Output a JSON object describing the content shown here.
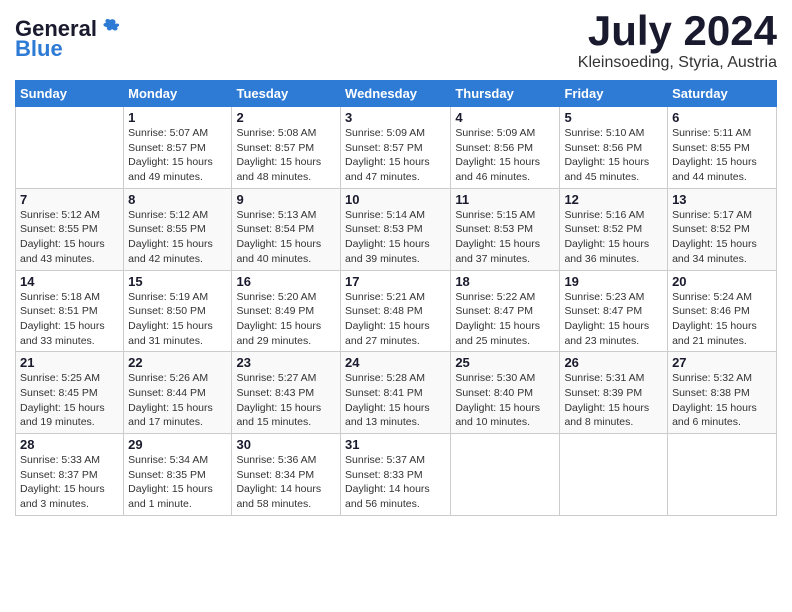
{
  "header": {
    "logo_general": "General",
    "logo_blue": "Blue",
    "month_title": "July 2024",
    "location": "Kleinsoeding, Styria, Austria"
  },
  "calendar": {
    "columns": [
      "Sunday",
      "Monday",
      "Tuesday",
      "Wednesday",
      "Thursday",
      "Friday",
      "Saturday"
    ],
    "weeks": [
      [
        {
          "day": "",
          "info": ""
        },
        {
          "day": "1",
          "info": "Sunrise: 5:07 AM\nSunset: 8:57 PM\nDaylight: 15 hours\nand 49 minutes."
        },
        {
          "day": "2",
          "info": "Sunrise: 5:08 AM\nSunset: 8:57 PM\nDaylight: 15 hours\nand 48 minutes."
        },
        {
          "day": "3",
          "info": "Sunrise: 5:09 AM\nSunset: 8:57 PM\nDaylight: 15 hours\nand 47 minutes."
        },
        {
          "day": "4",
          "info": "Sunrise: 5:09 AM\nSunset: 8:56 PM\nDaylight: 15 hours\nand 46 minutes."
        },
        {
          "day": "5",
          "info": "Sunrise: 5:10 AM\nSunset: 8:56 PM\nDaylight: 15 hours\nand 45 minutes."
        },
        {
          "day": "6",
          "info": "Sunrise: 5:11 AM\nSunset: 8:55 PM\nDaylight: 15 hours\nand 44 minutes."
        }
      ],
      [
        {
          "day": "7",
          "info": "Sunrise: 5:12 AM\nSunset: 8:55 PM\nDaylight: 15 hours\nand 43 minutes."
        },
        {
          "day": "8",
          "info": "Sunrise: 5:12 AM\nSunset: 8:55 PM\nDaylight: 15 hours\nand 42 minutes."
        },
        {
          "day": "9",
          "info": "Sunrise: 5:13 AM\nSunset: 8:54 PM\nDaylight: 15 hours\nand 40 minutes."
        },
        {
          "day": "10",
          "info": "Sunrise: 5:14 AM\nSunset: 8:53 PM\nDaylight: 15 hours\nand 39 minutes."
        },
        {
          "day": "11",
          "info": "Sunrise: 5:15 AM\nSunset: 8:53 PM\nDaylight: 15 hours\nand 37 minutes."
        },
        {
          "day": "12",
          "info": "Sunrise: 5:16 AM\nSunset: 8:52 PM\nDaylight: 15 hours\nand 36 minutes."
        },
        {
          "day": "13",
          "info": "Sunrise: 5:17 AM\nSunset: 8:52 PM\nDaylight: 15 hours\nand 34 minutes."
        }
      ],
      [
        {
          "day": "14",
          "info": "Sunrise: 5:18 AM\nSunset: 8:51 PM\nDaylight: 15 hours\nand 33 minutes."
        },
        {
          "day": "15",
          "info": "Sunrise: 5:19 AM\nSunset: 8:50 PM\nDaylight: 15 hours\nand 31 minutes."
        },
        {
          "day": "16",
          "info": "Sunrise: 5:20 AM\nSunset: 8:49 PM\nDaylight: 15 hours\nand 29 minutes."
        },
        {
          "day": "17",
          "info": "Sunrise: 5:21 AM\nSunset: 8:48 PM\nDaylight: 15 hours\nand 27 minutes."
        },
        {
          "day": "18",
          "info": "Sunrise: 5:22 AM\nSunset: 8:47 PM\nDaylight: 15 hours\nand 25 minutes."
        },
        {
          "day": "19",
          "info": "Sunrise: 5:23 AM\nSunset: 8:47 PM\nDaylight: 15 hours\nand 23 minutes."
        },
        {
          "day": "20",
          "info": "Sunrise: 5:24 AM\nSunset: 8:46 PM\nDaylight: 15 hours\nand 21 minutes."
        }
      ],
      [
        {
          "day": "21",
          "info": "Sunrise: 5:25 AM\nSunset: 8:45 PM\nDaylight: 15 hours\nand 19 minutes."
        },
        {
          "day": "22",
          "info": "Sunrise: 5:26 AM\nSunset: 8:44 PM\nDaylight: 15 hours\nand 17 minutes."
        },
        {
          "day": "23",
          "info": "Sunrise: 5:27 AM\nSunset: 8:43 PM\nDaylight: 15 hours\nand 15 minutes."
        },
        {
          "day": "24",
          "info": "Sunrise: 5:28 AM\nSunset: 8:41 PM\nDaylight: 15 hours\nand 13 minutes."
        },
        {
          "day": "25",
          "info": "Sunrise: 5:30 AM\nSunset: 8:40 PM\nDaylight: 15 hours\nand 10 minutes."
        },
        {
          "day": "26",
          "info": "Sunrise: 5:31 AM\nSunset: 8:39 PM\nDaylight: 15 hours\nand 8 minutes."
        },
        {
          "day": "27",
          "info": "Sunrise: 5:32 AM\nSunset: 8:38 PM\nDaylight: 15 hours\nand 6 minutes."
        }
      ],
      [
        {
          "day": "28",
          "info": "Sunrise: 5:33 AM\nSunset: 8:37 PM\nDaylight: 15 hours\nand 3 minutes."
        },
        {
          "day": "29",
          "info": "Sunrise: 5:34 AM\nSunset: 8:35 PM\nDaylight: 15 hours\nand 1 minute."
        },
        {
          "day": "30",
          "info": "Sunrise: 5:36 AM\nSunset: 8:34 PM\nDaylight: 14 hours\nand 58 minutes."
        },
        {
          "day": "31",
          "info": "Sunrise: 5:37 AM\nSunset: 8:33 PM\nDaylight: 14 hours\nand 56 minutes."
        },
        {
          "day": "",
          "info": ""
        },
        {
          "day": "",
          "info": ""
        },
        {
          "day": "",
          "info": ""
        }
      ]
    ]
  }
}
